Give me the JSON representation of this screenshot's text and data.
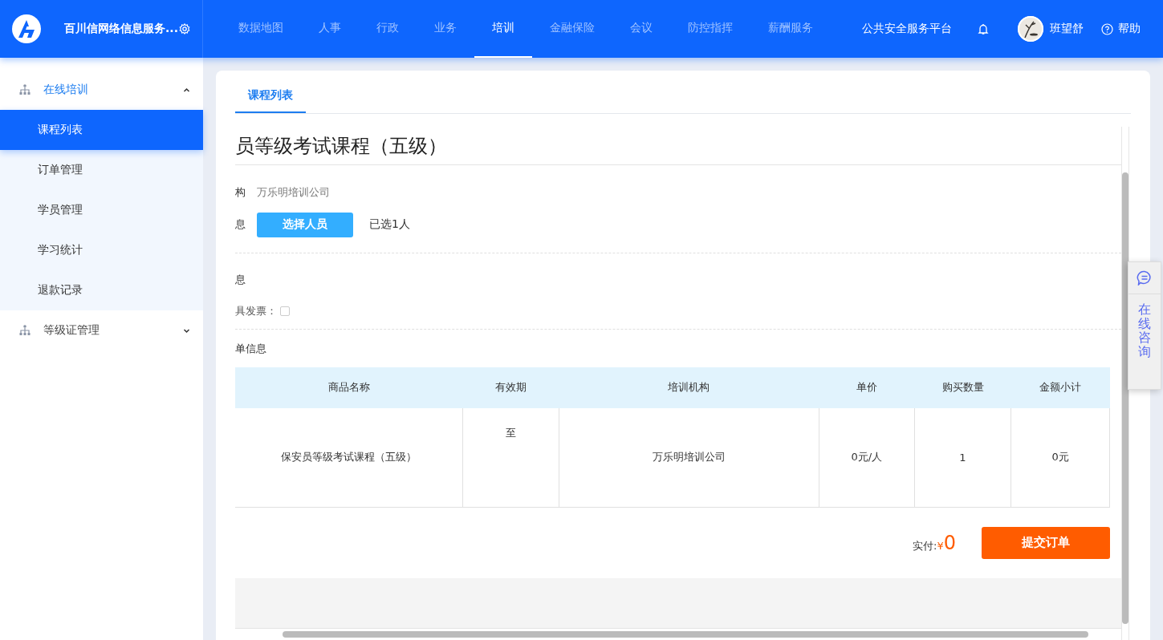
{
  "header": {
    "logo_title": "百川信网络信息服务...",
    "nav": [
      {
        "label": "数据地图",
        "selected": false
      },
      {
        "label": "人事",
        "selected": false
      },
      {
        "label": "行政",
        "selected": false
      },
      {
        "label": "业务",
        "selected": false
      },
      {
        "label": "培训",
        "selected": true
      },
      {
        "label": "金融保险",
        "selected": false
      },
      {
        "label": "会议",
        "selected": false
      },
      {
        "label": "防控指挥",
        "selected": false
      },
      {
        "label": "薪酬服务",
        "selected": false
      }
    ],
    "platform": "公共安全服务平台",
    "user": "班望舒",
    "help": "帮助"
  },
  "sidebar": {
    "groups": [
      {
        "label": "在线培训",
        "expanded": true,
        "items": [
          {
            "label": "课程列表",
            "selected": true
          },
          {
            "label": "订单管理",
            "selected": false
          },
          {
            "label": "学员管理",
            "selected": false
          },
          {
            "label": "学习统计",
            "selected": false
          },
          {
            "label": "退款记录",
            "selected": false
          }
        ]
      },
      {
        "label": "等级证管理",
        "expanded": false
      }
    ]
  },
  "tabs": [
    {
      "label": "课程列表",
      "selected": true
    }
  ],
  "course": {
    "title": "员等级考试课程（五级）",
    "fields": [
      {
        "kind": "text",
        "label": "构",
        "value": "万乐明培训公司"
      },
      {
        "kind": "picker",
        "label": "息",
        "button": "选择人员",
        "note": "已选1人"
      }
    ],
    "invoice": {
      "heading": "息",
      "checkbox_label": "具发票：",
      "checked": false
    },
    "order": {
      "heading": "单信息",
      "columns": [
        "商品名称",
        "有效期",
        "培训机构",
        "单价",
        "购买数量",
        "金额小计"
      ],
      "rows": [
        [
          "保安员等级考试课程（五级）",
          "至",
          "万乐明培训公司",
          "0元/人",
          "1",
          "0元"
        ]
      ]
    },
    "total_label": "实付:",
    "currency": "¥",
    "total": "0",
    "submit": "提交订单"
  },
  "consult": {
    "label": "在线咨询"
  }
}
